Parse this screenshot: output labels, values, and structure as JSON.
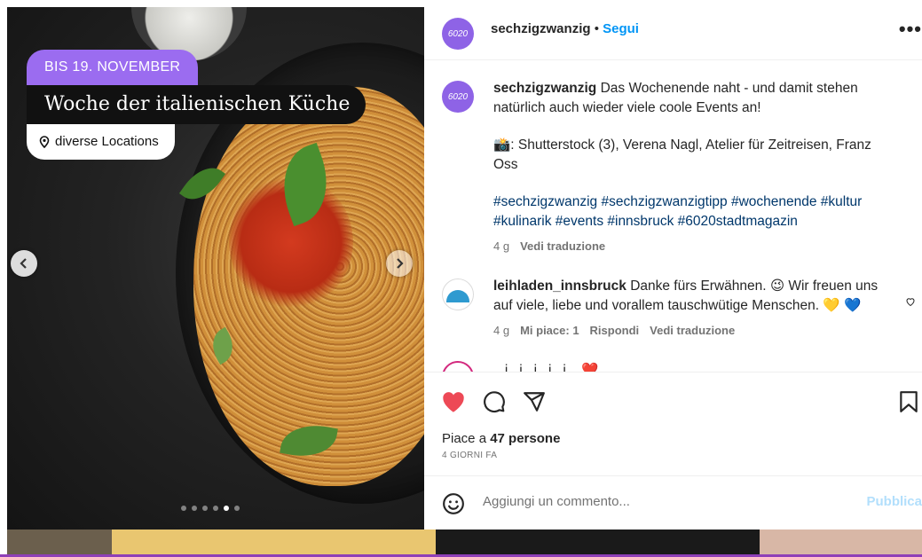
{
  "media": {
    "badge_date": "BIS 19. NOVEMBER",
    "badge_title": "Woche der italienischen Küche",
    "badge_location": "diverse Locations",
    "carousel": {
      "total": 6,
      "active_index": 4
    }
  },
  "header": {
    "username": "sechzigzwanzig",
    "separator": " • ",
    "follow_label": "Segui",
    "more_label": "•••",
    "avatar_text": "6020"
  },
  "caption": {
    "username": "sechzigzwanzig",
    "text": " Das Wochenende naht - und damit stehen natürlich auch wieder viele coole Events an!",
    "credits": "📸: Shutterstock (3), Verena Nagl, Atelier für Zeitreisen, Franz Oss",
    "hashtags": "#sechzigzwanzig #sechzigzwanzigtipp #wochenende #kultur #kulinarik #events #innsbruck #6020stadtmagazin",
    "time": "4 g",
    "translate": "Vedi traduzione"
  },
  "comment1": {
    "username": "leihladen_innsbruck",
    "text": " Danke fürs Erwähnen. 😉 Wir freuen uns auf viele, liebe und vorallem tauschwütige Menschen. 💛 💙",
    "time": "4 g",
    "likes": "Mi piace: 1",
    "reply": "Rispondi",
    "translate": "Vedi traduzione"
  },
  "comment2": {
    "text": "...i...i...i...i...i... ❤️"
  },
  "actions": {
    "likes_prefix": "Piace a ",
    "likes_count": "47 persone",
    "time_ago": "4 GIORNI FA"
  },
  "add_comment": {
    "placeholder": "Aggiungi un commento...",
    "publish_label": "Pubblica"
  },
  "colors": {
    "accent": "#0095f6",
    "like_red": "#ed4956",
    "badge_purple": "#9b6cf0"
  }
}
